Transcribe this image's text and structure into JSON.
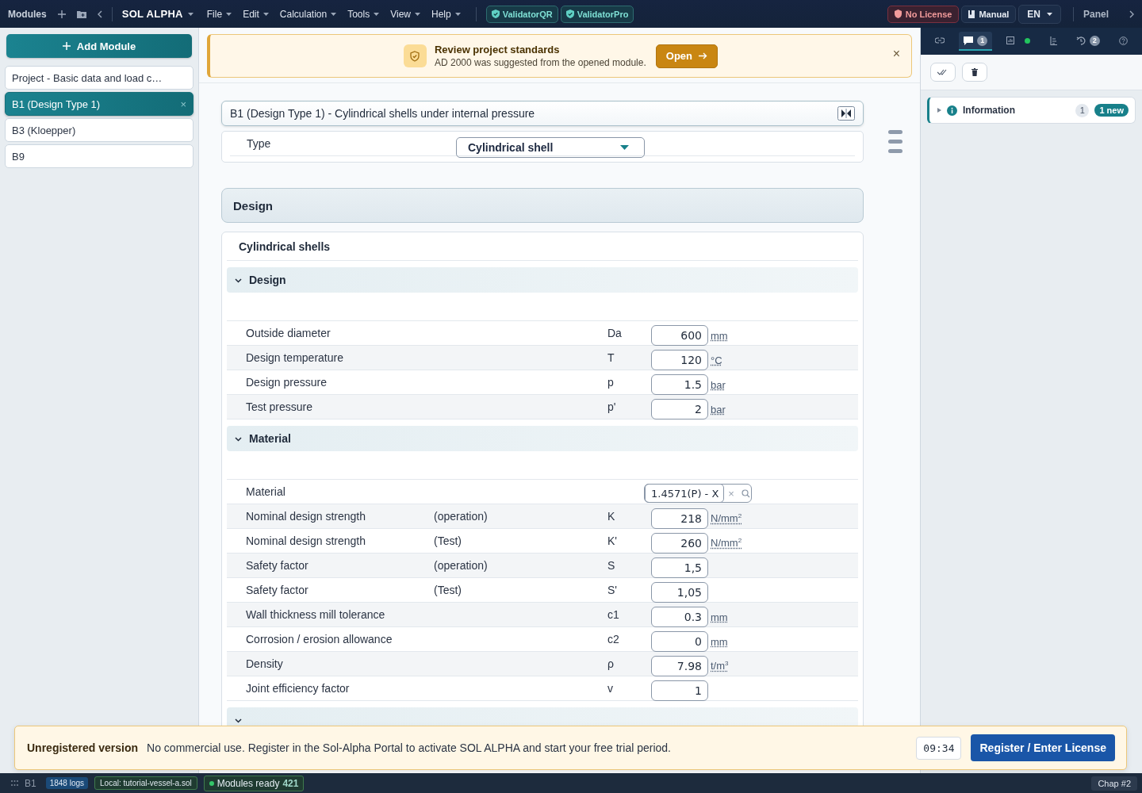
{
  "topbar": {
    "modules_label": "Modules",
    "app_name": "SOL ALPHA",
    "menus": [
      "File",
      "Edit",
      "Calculation",
      "Tools",
      "View",
      "Help"
    ],
    "validators": [
      "ValidatorQR",
      "ValidatorPro"
    ],
    "license": "No License",
    "manual": "Manual",
    "language": "EN",
    "panel": "Panel"
  },
  "sidebar": {
    "add_button": "Add Module",
    "items": [
      {
        "label": "Project - Basic data and load c…",
        "selected": false,
        "closable": false
      },
      {
        "label": "B1 (Design Type 1)",
        "selected": true,
        "closable": true,
        "close": "×"
      },
      {
        "label": "B3 (Kloepper)",
        "selected": false,
        "closable": false
      },
      {
        "label": "B9",
        "selected": false,
        "closable": false
      }
    ]
  },
  "notice": {
    "title": "Review project standards",
    "text": "AD 2000 was suggested from the opened module.",
    "button": "Open",
    "close": "×"
  },
  "module": {
    "title": "B1 (Design Type 1) - Cylindrical shells under internal pressure",
    "type_label": "Type",
    "type_value": "Cylindrical shell"
  },
  "design": {
    "heading": "Design",
    "card_title": "Cylindrical shells",
    "sections": [
      {
        "title": "Design",
        "expanded": true,
        "rows": [
          {
            "kind": "number",
            "label": "Outside diameter",
            "symbol": "Da",
            "value": "600",
            "unit": "mm"
          },
          {
            "kind": "number",
            "label": "Design temperature",
            "symbol": "T",
            "value": "120",
            "unit": "°C"
          },
          {
            "kind": "number",
            "label": "Design pressure",
            "symbol": "p",
            "value": "1.5",
            "unit": "bar"
          },
          {
            "kind": "number",
            "label": "Test pressure",
            "symbol": "p'",
            "value": "2",
            "unit": "bar"
          }
        ]
      },
      {
        "title": "Material",
        "expanded": true,
        "rows": [
          {
            "kind": "material",
            "label": "Material",
            "value": "1.4571(P) - X",
            "clear": "×"
          },
          {
            "kind": "number",
            "label": "Nominal design strength",
            "qualifier": "(operation)",
            "symbol": "K",
            "value": "218",
            "unit": "N/mm$^{2}$"
          },
          {
            "kind": "number",
            "label": "Nominal design strength",
            "qualifier": "(Test)",
            "symbol": "K'",
            "value": "260",
            "unit": "N/mm$^{2}$"
          },
          {
            "kind": "number",
            "label": "Safety factor",
            "qualifier": "(operation)",
            "symbol": "S",
            "value": "1,5"
          },
          {
            "kind": "number",
            "label": "Safety factor",
            "qualifier": "(Test)",
            "symbol": "S'",
            "value": "1,05"
          },
          {
            "kind": "number",
            "label": "Wall thickness mill tolerance",
            "symbol": "c1",
            "value": "0.3",
            "unit": "mm"
          },
          {
            "kind": "number",
            "label": "Corrosion / erosion allowance",
            "symbol": "c2",
            "value": "0",
            "unit": "mm"
          },
          {
            "kind": "number",
            "label": "Density",
            "symbol": "ρ",
            "value": "7.98",
            "unit": "t/m$^{3}$"
          },
          {
            "kind": "number",
            "label": "Joint efficiency factor",
            "symbol": "v",
            "value": "1"
          }
        ]
      },
      {
        "expanded": true
      }
    ]
  },
  "panel": {
    "tabs": [
      {
        "kind": "link",
        "selected": false
      },
      {
        "kind": "comments",
        "selected": true,
        "badge": "1"
      },
      {
        "kind": "chart",
        "selected": false,
        "color": "#22c55e"
      },
      {
        "kind": "tree",
        "selected": false
      },
      {
        "kind": "history",
        "selected": false,
        "badge": "2"
      },
      {
        "kind": "help",
        "selected": false
      }
    ],
    "groups": [
      {
        "label": "Information",
        "expanded": false,
        "count": "1",
        "new": "1 new"
      }
    ]
  },
  "license_banner": {
    "title": "Unregistered version",
    "text": "No commercial use. Register in the Sol-Alpha Portal to activate SOL ALPHA and start your free trial period.",
    "timer": "09:34",
    "button": "Register / Enter License"
  },
  "status_bar": {
    "module": "B1",
    "logs": "1848 logs",
    "file": "Local: tutorial-vessel-a.sol",
    "ready": "Modules ready",
    "ready_count": "421",
    "chapter": "Chap #2"
  }
}
